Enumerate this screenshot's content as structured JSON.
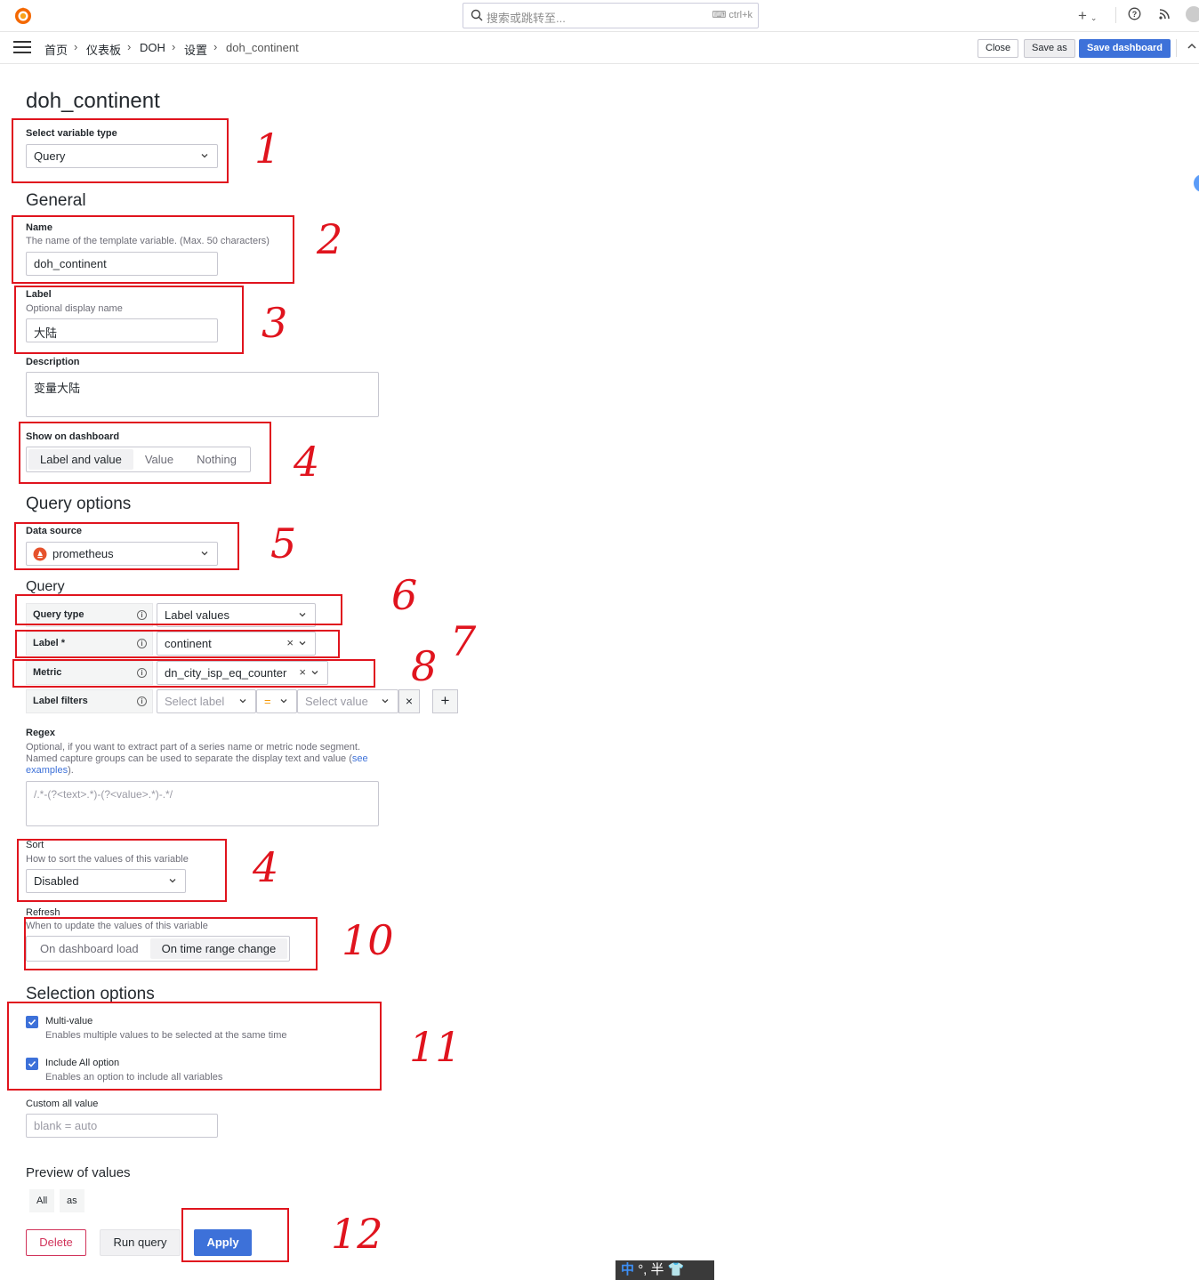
{
  "topbar": {
    "search_placeholder": "搜索或跳转至...",
    "search_shortcut": "ctrl+k",
    "plus_label": "+"
  },
  "breadcrumb": [
    "首页",
    "仪表板",
    "DOH",
    "设置",
    "doh_continent"
  ],
  "toolbar": {
    "close": "Close",
    "save_as": "Save as",
    "save_dashboard": "Save dashboard"
  },
  "page_title": "doh_continent",
  "variable_type": {
    "label": "Select variable type",
    "value": "Query"
  },
  "general": {
    "heading": "General",
    "name_label": "Name",
    "name_desc": "The name of the template variable. (Max. 50 characters)",
    "name_value": "doh_continent",
    "label_label": "Label",
    "label_desc": "Optional display name",
    "label_value": "大陆",
    "description_label": "Description",
    "description_value": "变量大陆",
    "show_label": "Show on dashboard",
    "show_options": [
      "Label and value",
      "Value",
      "Nothing"
    ],
    "show_selected": "Label and value"
  },
  "query_options": {
    "heading": "Query options",
    "datasource_label": "Data source",
    "datasource_value": "prometheus",
    "query_heading": "Query",
    "query_type_label": "Query type",
    "query_type_value": "Label values",
    "label_label": "Label *",
    "label_value": "continent",
    "metric_label": "Metric",
    "metric_value": "dn_city_isp_eq_counter",
    "filters_label": "Label filters",
    "filter_label_ph": "Select label",
    "filter_op": "=",
    "filter_value_ph": "Select value",
    "regex_label": "Regex",
    "regex_desc1": "Optional, if you want to extract part of a series name or metric node segment.",
    "regex_desc2": "Named capture groups can be used to separate the display text and value (",
    "regex_link1": "see",
    "regex_link2": "examples",
    "regex_desc3": ").",
    "regex_placeholder": "/.*-(?<text>.*)-(?<value>.*)-.*/",
    "sort_label": "Sort",
    "sort_desc": "How to sort the values of this variable",
    "sort_value": "Disabled",
    "refresh_label": "Refresh",
    "refresh_desc": "When to update the values of this variable",
    "refresh_options": [
      "On dashboard load",
      "On time range change"
    ],
    "refresh_selected": "On time range change"
  },
  "selection_options": {
    "heading": "Selection options",
    "multi_label": "Multi-value",
    "multi_desc": "Enables multiple values to be selected at the same time",
    "multi_checked": true,
    "include_all_label": "Include All option",
    "include_all_desc": "Enables an option to include all variables",
    "include_all_checked": true,
    "custom_all_label": "Custom all value",
    "custom_all_placeholder": "blank = auto"
  },
  "preview": {
    "heading": "Preview of values",
    "values": [
      "All",
      "as"
    ]
  },
  "actions": {
    "delete": "Delete",
    "run_query": "Run query",
    "apply": "Apply"
  },
  "annotations": [
    "1",
    "2",
    "3",
    "4",
    "5",
    "6",
    "7",
    "8",
    "4",
    "10",
    "11",
    "12"
  ],
  "ime": {
    "mode": "中",
    "rest": "°, 半"
  },
  "colors": {
    "accent": "#3d71d9",
    "annotation": "#e0141e",
    "danger": "#d1335a"
  }
}
